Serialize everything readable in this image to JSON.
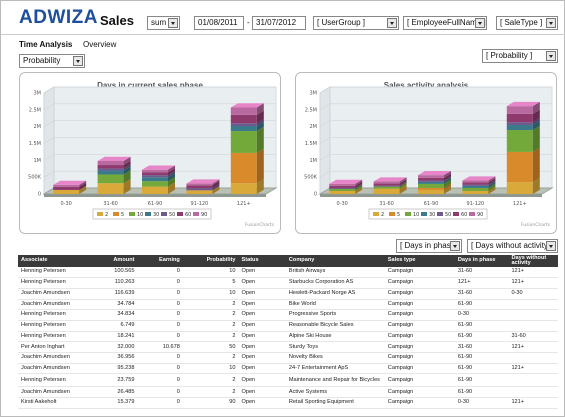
{
  "header": {
    "logo": "ADWIZA",
    "title": "Sales",
    "measure_select": "sum",
    "date_from": "01/08/2011",
    "date_sep": "-",
    "date_to": "31/07/2012",
    "filter1": "[ UserGroup ]",
    "filter2": "[ EmployeeFullName ]",
    "filter3": "[ SaleType ]"
  },
  "tabs": [
    {
      "label": "Time Analysis",
      "active": true
    },
    {
      "label": "Overview",
      "active": false
    }
  ],
  "left_select": "Probability",
  "right_select": "[ Probability ]",
  "chart_controls": {
    "select1": "[ Days in phase ]",
    "select2": "[ Days without activity ]"
  },
  "chart_data": [
    {
      "type": "bar",
      "title": "Days in current sales phase",
      "credit": "FusionCharts",
      "categories": [
        "0-30",
        "31-60",
        "61-90",
        "91-120",
        "121+"
      ],
      "ylabels": [
        "0",
        "500K",
        "1M",
        "1.5M",
        "2M",
        "2.5M",
        "3M"
      ],
      "ylim": [
        0,
        3000000
      ],
      "legend": [
        "2",
        "5",
        "10",
        "30",
        "50",
        "60",
        "90"
      ],
      "series_colors": [
        "#d9a93a",
        "#d98b2b",
        "#73a83a",
        "#3a7a8a",
        "#6d5a8e",
        "#8e3a6d",
        "#b86aa0"
      ],
      "series": [
        {
          "name": "2",
          "values": [
            120000,
            320000,
            220000,
            110000,
            320000
          ]
        },
        {
          "name": "5",
          "values": [
            0,
            0,
            0,
            0,
            900000
          ]
        },
        {
          "name": "10",
          "values": [
            0,
            260000,
            160000,
            0,
            650000
          ]
        },
        {
          "name": "30",
          "values": [
            0,
            120000,
            120000,
            0,
            150000
          ]
        },
        {
          "name": "50",
          "values": [
            0,
            60000,
            60000,
            60000,
            80000
          ]
        },
        {
          "name": "60",
          "values": [
            90000,
            100000,
            80000,
            90000,
            250000
          ]
        },
        {
          "name": "90",
          "values": [
            60000,
            120000,
            80000,
            50000,
            220000
          ]
        }
      ]
    },
    {
      "type": "bar",
      "title": "Sales activity analysis",
      "credit": "FusionCharts",
      "categories": [
        "0-30",
        "31-60",
        "61-90",
        "91-120",
        "121+"
      ],
      "ylabels": [
        "0",
        "500K",
        "1M",
        "1.5M",
        "2M",
        "2.5M",
        "3M"
      ],
      "ylim": [
        0,
        3000000
      ],
      "legend": [
        "2",
        "5",
        "10",
        "30",
        "50",
        "60",
        "90"
      ],
      "series_colors": [
        "#d9a93a",
        "#d98b2b",
        "#73a83a",
        "#3a7a8a",
        "#6d5a8e",
        "#8e3a6d",
        "#b86aa0"
      ],
      "series": [
        {
          "name": "2",
          "values": [
            90000,
            160000,
            120000,
            90000,
            350000
          ]
        },
        {
          "name": "5",
          "values": [
            0,
            0,
            60000,
            0,
            900000
          ]
        },
        {
          "name": "10",
          "values": [
            60000,
            60000,
            120000,
            90000,
            650000
          ]
        },
        {
          "name": "30",
          "values": [
            0,
            0,
            60000,
            60000,
            150000
          ]
        },
        {
          "name": "50",
          "values": [
            30000,
            30000,
            40000,
            40000,
            80000
          ]
        },
        {
          "name": "60",
          "values": [
            60000,
            60000,
            80000,
            60000,
            250000
          ]
        },
        {
          "name": "90",
          "values": [
            60000,
            60000,
            80000,
            60000,
            230000
          ]
        }
      ]
    }
  ],
  "table": {
    "headers": [
      "Associate",
      "Amount",
      "Earning",
      "Probability",
      "Status",
      "Company",
      "Sales type",
      "Days in phase",
      "Days without activity"
    ],
    "rows": [
      [
        "Henning Petersen",
        "100.565",
        "0",
        "10",
        "Open",
        "British Airways",
        "Campaign",
        "31-60",
        "121+"
      ],
      [
        "Henning Petersen",
        "110.263",
        "0",
        "5",
        "Open",
        "Starbucks Corporation AS",
        "Campaign",
        "121+",
        "121+"
      ],
      [
        "Joachim Amundsen",
        "116.639",
        "0",
        "10",
        "Open",
        "Hewlett-Packard Norge AS",
        "Campaign",
        "31-60",
        "0-30"
      ],
      [
        "Joachim Amundsen",
        "34.784",
        "0",
        "2",
        "Open",
        "Bike World",
        "Campaign",
        "61-90",
        ""
      ],
      [
        "Henning Petersen",
        "34.834",
        "0",
        "2",
        "Open",
        "Progressive Sports",
        "Campaign",
        "0-30",
        ""
      ],
      [
        "Henning Petersen",
        "6.749",
        "0",
        "2",
        "Open",
        "Reasonable Bicycle Sales",
        "Campaign",
        "61-90",
        ""
      ],
      [
        "Henning Petersen",
        "18.241",
        "0",
        "2",
        "Open",
        "Alpine Ski House",
        "Campaign",
        "61-90",
        "31-60"
      ],
      [
        "Per Anton Inghart",
        "32.000",
        "10.678",
        "50",
        "Open",
        "Sturdy Toys",
        "Campaign",
        "31-60",
        "121+"
      ],
      [
        "Joachim Amundsen",
        "36.956",
        "0",
        "2",
        "Open",
        "Novelty Bikes",
        "Campaign",
        "61-90",
        ""
      ],
      [
        "Joachim Amundsen",
        "95.238",
        "0",
        "10",
        "Open",
        "24-7 Entertainment ApS",
        "Campaign",
        "61-90",
        "121+"
      ],
      [
        "Henning Petersen",
        "23.759",
        "0",
        "2",
        "Open",
        "Maintenance and Repair for Bicycles",
        "Campaign",
        "61-90",
        ""
      ],
      [
        "Joachim Amundsen",
        "26.485",
        "0",
        "2",
        "Open",
        "Active Systems",
        "Campaign",
        "61-90",
        ""
      ],
      [
        "Kirsti Aakeholt",
        "15.379",
        "0",
        "90",
        "Open",
        "Retail Sporting Equipment",
        "Campaign",
        "0-30",
        "121+"
      ]
    ]
  }
}
